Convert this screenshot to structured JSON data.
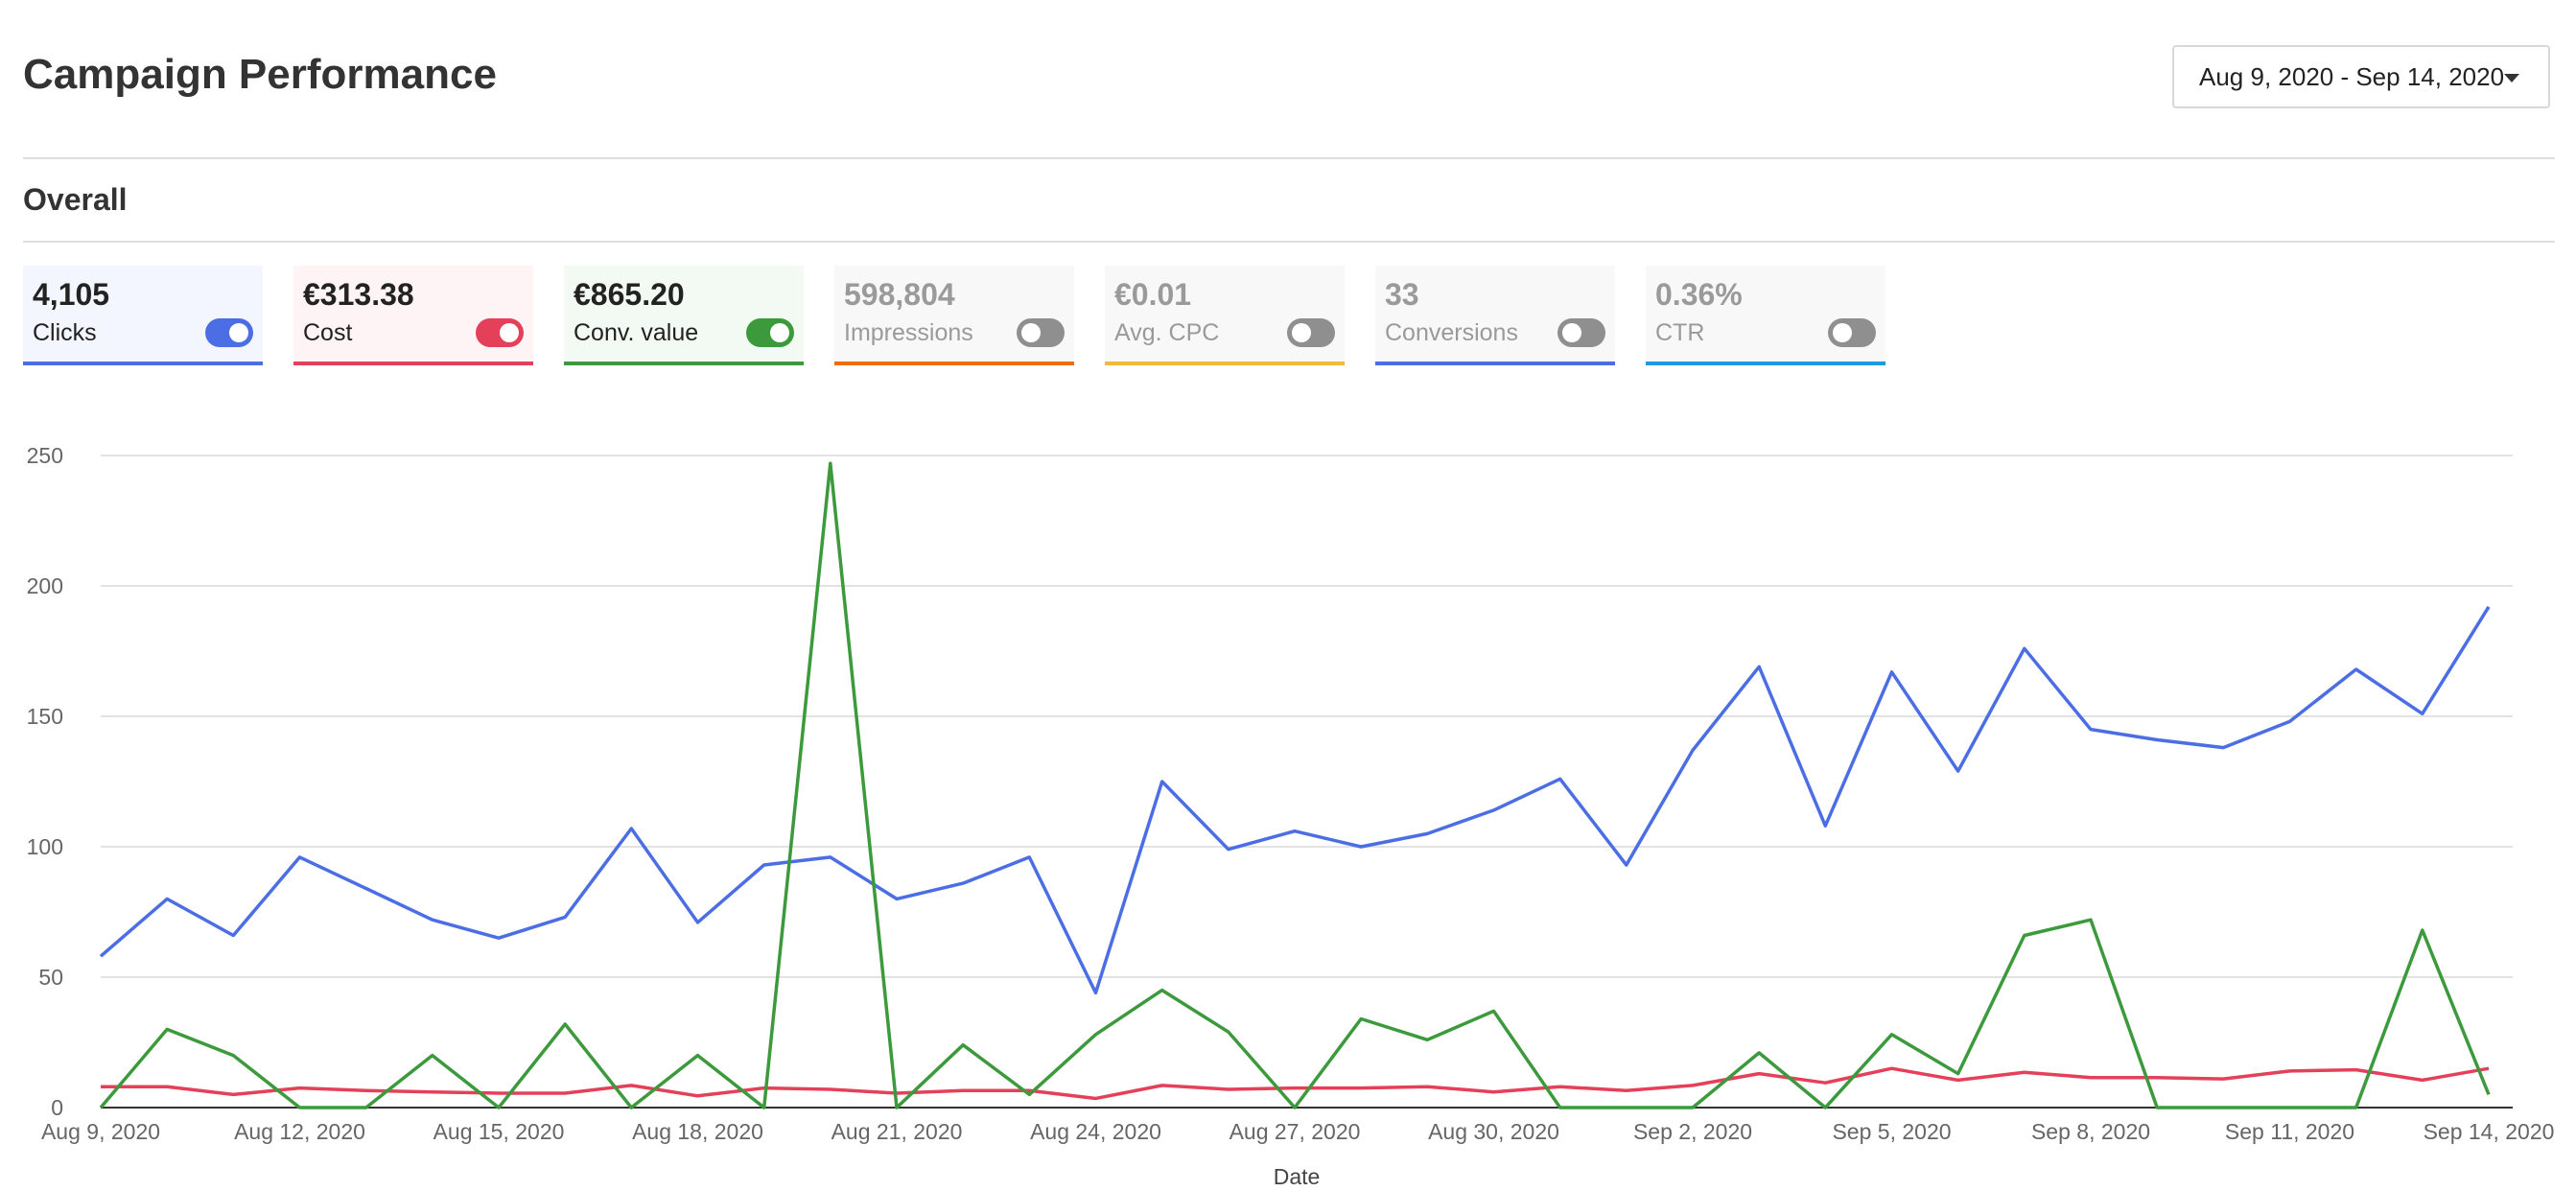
{
  "header": {
    "title": "Campaign Performance",
    "date_range": "Aug 9, 2020 - Sep 14, 2020"
  },
  "section": {
    "title": "Overall"
  },
  "metrics": [
    {
      "value": "4,105",
      "label": "Clicks",
      "enabled": true,
      "color": "#4c6ee5",
      "bg": "#f4f6ff"
    },
    {
      "value": "€313.38",
      "label": "Cost",
      "enabled": true,
      "color": "#e5405a",
      "bg": "#fff4f5"
    },
    {
      "value": "€865.20",
      "label": "Conv. value",
      "enabled": true,
      "color": "#3c9a3c",
      "bg": "#f3f9f3"
    },
    {
      "value": "598,804",
      "label": "Impressions",
      "enabled": false,
      "color": "#ef6c00",
      "bg": "#f8f8f8"
    },
    {
      "value": "€0.01",
      "label": "Avg. CPC",
      "enabled": false,
      "color": "#f5b93a",
      "bg": "#f8f8f8"
    },
    {
      "value": "33",
      "label": "Conversions",
      "enabled": false,
      "color": "#4c6ee5",
      "bg": "#f8f8f8"
    },
    {
      "value": "0.36%",
      "label": "CTR",
      "enabled": false,
      "color": "#1e9be0",
      "bg": "#f8f8f8"
    }
  ],
  "chart_data": {
    "type": "line",
    "x": [
      "Aug 9, 2020",
      "Aug 10, 2020",
      "Aug 11, 2020",
      "Aug 12, 2020",
      "Aug 13, 2020",
      "Aug 14, 2020",
      "Aug 15, 2020",
      "Aug 16, 2020",
      "Aug 17, 2020",
      "Aug 18, 2020",
      "Aug 19, 2020",
      "Aug 20, 2020",
      "Aug 21, 2020",
      "Aug 22, 2020",
      "Aug 23, 2020",
      "Aug 24, 2020",
      "Aug 25, 2020",
      "Aug 26, 2020",
      "Aug 27, 2020",
      "Aug 28, 2020",
      "Aug 29, 2020",
      "Aug 30, 2020",
      "Aug 31, 2020",
      "Sep 1, 2020",
      "Sep 2, 2020",
      "Sep 3, 2020",
      "Sep 4, 2020",
      "Sep 5, 2020",
      "Sep 6, 2020",
      "Sep 7, 2020",
      "Sep 8, 2020",
      "Sep 9, 2020",
      "Sep 10, 2020",
      "Sep 11, 2020",
      "Sep 12, 2020",
      "Sep 13, 2020",
      "Sep 14, 2020"
    ],
    "x_tick_labels": [
      "Aug 9, 2020",
      "Aug 12, 2020",
      "Aug 15, 2020",
      "Aug 18, 2020",
      "Aug 21, 2020",
      "Aug 24, 2020",
      "Aug 27, 2020",
      "Aug 30, 2020",
      "Sep 2, 2020",
      "Sep 5, 2020",
      "Sep 8, 2020",
      "Sep 11, 2020",
      "Sep 14, 2020"
    ],
    "y_ticks": [
      0,
      50,
      100,
      150,
      200,
      250
    ],
    "ylim": [
      0,
      250
    ],
    "xlabel": "Date",
    "ylabel": "",
    "grid": true,
    "series": [
      {
        "name": "Clicks",
        "color": "#4c6ee5",
        "values": [
          58,
          80,
          66,
          96,
          84,
          72,
          65,
          73,
          107,
          71,
          93,
          96,
          80,
          86,
          96,
          44,
          125,
          99,
          106,
          100,
          105,
          114,
          126,
          93,
          137,
          169,
          108,
          167,
          129,
          176,
          145,
          141,
          138,
          148,
          168,
          151,
          192
        ]
      },
      {
        "name": "Cost",
        "color": "#e5405a",
        "values": [
          8,
          8,
          5,
          7.5,
          6.5,
          6,
          5.5,
          5.5,
          8.5,
          4.5,
          7.5,
          7,
          5.5,
          6.5,
          6.5,
          3.5,
          8.5,
          7,
          7.5,
          7.5,
          8,
          6,
          8,
          6.5,
          8.5,
          13,
          9.5,
          15,
          10.5,
          13.5,
          11.5,
          11.5,
          11,
          14,
          14.5,
          10.5,
          15
        ]
      },
      {
        "name": "Conv. value",
        "color": "#3c9a3c",
        "values": [
          0,
          30,
          20,
          0,
          0,
          20,
          0,
          32,
          0,
          20,
          0,
          247,
          0,
          24,
          5,
          28,
          45,
          29,
          0,
          34,
          26,
          37,
          0,
          0,
          0,
          21,
          0,
          28,
          13,
          66,
          72,
          0,
          0,
          0,
          0,
          68,
          5
        ]
      }
    ]
  }
}
